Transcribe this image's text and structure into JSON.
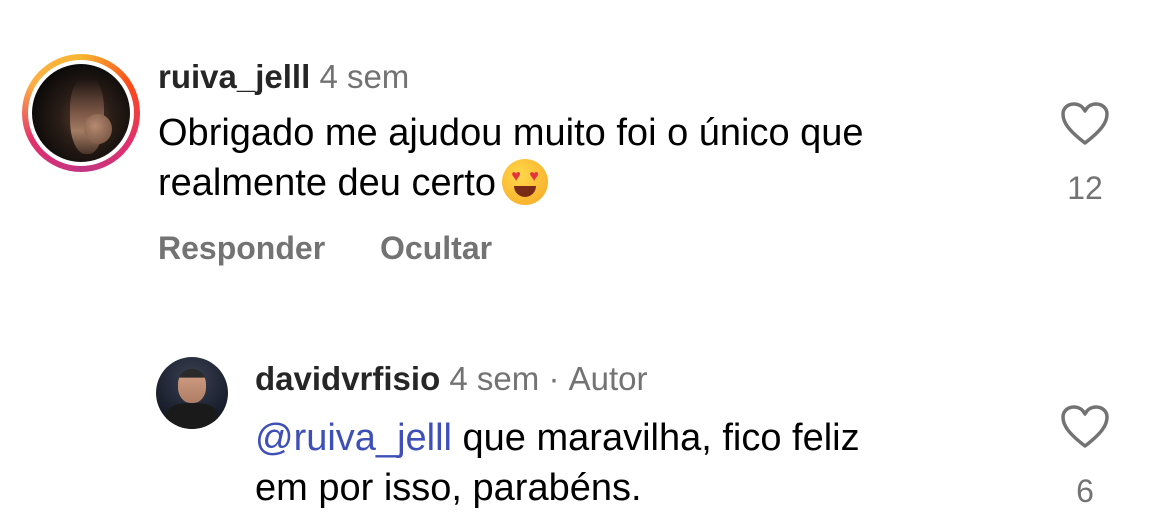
{
  "comments": [
    {
      "username": "ruiva_jelll",
      "time": "4 sem",
      "text_line1": "Obrigado me ajudou muito foi o único que",
      "text_line2": "realmente deu certo",
      "emoji": "heart-eyes-emoji",
      "like_count": "12",
      "actions": {
        "reply": "Responder",
        "hide": "Ocultar"
      }
    }
  ],
  "reply": {
    "username": "davidvrfisio",
    "time": "4 sem",
    "separator": "·",
    "author_badge": "Autor",
    "mention": "@ruiva_jelll",
    "text_line1_rest": " que maravilha, fico feliz",
    "text_line2": "em por isso, parabéns.",
    "like_count": "6"
  }
}
